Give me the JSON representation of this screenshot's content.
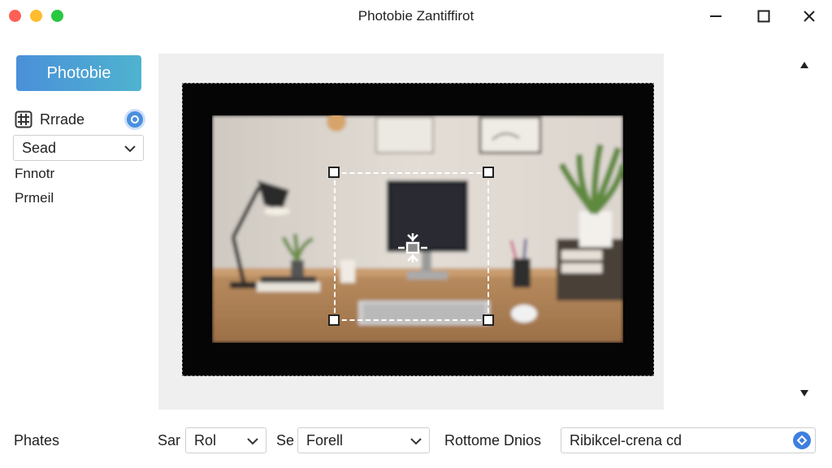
{
  "window": {
    "title": "Photobie Zantiffirot"
  },
  "sidebar": {
    "primary_button": "Photobie",
    "tool_label": "Rrrade",
    "select_value": "Sead",
    "item_1": "Fnnotr",
    "item_2": "Prmeil"
  },
  "canvas": {
    "scroll_up_icon": "triangle-up-icon",
    "scroll_down_icon": "triangle-down-icon"
  },
  "bottom": {
    "left_label": "Phates",
    "label_sar": "Sar",
    "select_1": "Rol",
    "label_se": "Se",
    "select_2": "Forell",
    "label_rotate": "Rottome Dnios",
    "combo_value": "Ribikcel-crena cd"
  },
  "colors": {
    "accent": "#4a90d9",
    "accent_end": "#4fb3cf",
    "traffic_red": "#ff5f57",
    "traffic_yellow": "#febc2e",
    "traffic_green": "#28c840"
  }
}
